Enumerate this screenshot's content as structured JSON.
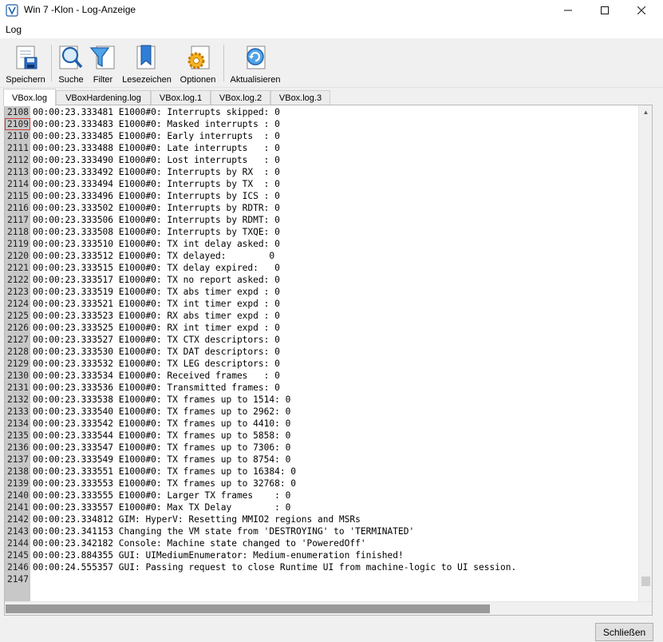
{
  "window": {
    "title": "Win 7 -Klon - Log-Anzeige"
  },
  "menu": {
    "items": [
      "Log"
    ]
  },
  "toolbar": {
    "buttons": [
      {
        "label": "Speichern",
        "icon": "save-icon"
      },
      {
        "label": "Suche",
        "icon": "search-icon"
      },
      {
        "label": "Filter",
        "icon": "filter-icon"
      },
      {
        "label": "Lesezeichen",
        "icon": "bookmark-icon"
      },
      {
        "label": "Optionen",
        "icon": "gear-icon"
      },
      {
        "label": "Aktualisieren",
        "icon": "refresh-icon"
      }
    ]
  },
  "tabs": [
    "VBox.log",
    "VBoxHardening.log",
    "VBox.log.1",
    "VBox.log.2",
    "VBox.log.3"
  ],
  "active_tab": 0,
  "log": {
    "selected_line": "2109",
    "lines": [
      {
        "n": "2108",
        "t": "00:00:23.333481 E1000#0: Interrupts skipped: 0"
      },
      {
        "n": "2109",
        "t": "00:00:23.333483 E1000#0: Masked interrupts : 0"
      },
      {
        "n": "2110",
        "t": "00:00:23.333485 E1000#0: Early interrupts  : 0"
      },
      {
        "n": "2111",
        "t": "00:00:23.333488 E1000#0: Late interrupts   : 0"
      },
      {
        "n": "2112",
        "t": "00:00:23.333490 E1000#0: Lost interrupts   : 0"
      },
      {
        "n": "2113",
        "t": "00:00:23.333492 E1000#0: Interrupts by RX  : 0"
      },
      {
        "n": "2114",
        "t": "00:00:23.333494 E1000#0: Interrupts by TX  : 0"
      },
      {
        "n": "2115",
        "t": "00:00:23.333496 E1000#0: Interrupts by ICS : 0"
      },
      {
        "n": "2116",
        "t": "00:00:23.333502 E1000#0: Interrupts by RDTR: 0"
      },
      {
        "n": "2117",
        "t": "00:00:23.333506 E1000#0: Interrupts by RDMT: 0"
      },
      {
        "n": "2118",
        "t": "00:00:23.333508 E1000#0: Interrupts by TXQE: 0"
      },
      {
        "n": "2119",
        "t": "00:00:23.333510 E1000#0: TX int delay asked: 0"
      },
      {
        "n": "2120",
        "t": "00:00:23.333512 E1000#0: TX delayed:        0"
      },
      {
        "n": "2121",
        "t": "00:00:23.333515 E1000#0: TX delay expired:   0"
      },
      {
        "n": "2122",
        "t": "00:00:23.333517 E1000#0: TX no report asked: 0"
      },
      {
        "n": "2123",
        "t": "00:00:23.333519 E1000#0: TX abs timer expd : 0"
      },
      {
        "n": "2124",
        "t": "00:00:23.333521 E1000#0: TX int timer expd : 0"
      },
      {
        "n": "2125",
        "t": "00:00:23.333523 E1000#0: RX abs timer expd : 0"
      },
      {
        "n": "2126",
        "t": "00:00:23.333525 E1000#0: RX int timer expd : 0"
      },
      {
        "n": "2127",
        "t": "00:00:23.333527 E1000#0: TX CTX descriptors: 0"
      },
      {
        "n": "2128",
        "t": "00:00:23.333530 E1000#0: TX DAT descriptors: 0"
      },
      {
        "n": "2129",
        "t": "00:00:23.333532 E1000#0: TX LEG descriptors: 0"
      },
      {
        "n": "2130",
        "t": "00:00:23.333534 E1000#0: Received frames   : 0"
      },
      {
        "n": "2131",
        "t": "00:00:23.333536 E1000#0: Transmitted frames: 0"
      },
      {
        "n": "2132",
        "t": "00:00:23.333538 E1000#0: TX frames up to 1514: 0"
      },
      {
        "n": "2133",
        "t": "00:00:23.333540 E1000#0: TX frames up to 2962: 0"
      },
      {
        "n": "2134",
        "t": "00:00:23.333542 E1000#0: TX frames up to 4410: 0"
      },
      {
        "n": "2135",
        "t": "00:00:23.333544 E1000#0: TX frames up to 5858: 0"
      },
      {
        "n": "2136",
        "t": "00:00:23.333547 E1000#0: TX frames up to 7306: 0"
      },
      {
        "n": "2137",
        "t": "00:00:23.333549 E1000#0: TX frames up to 8754: 0"
      },
      {
        "n": "2138",
        "t": "00:00:23.333551 E1000#0: TX frames up to 16384: 0"
      },
      {
        "n": "2139",
        "t": "00:00:23.333553 E1000#0: TX frames up to 32768: 0"
      },
      {
        "n": "2140",
        "t": "00:00:23.333555 E1000#0: Larger TX frames    : 0"
      },
      {
        "n": "2141",
        "t": "00:00:23.333557 E1000#0: Max TX Delay        : 0"
      },
      {
        "n": "2142",
        "t": "00:00:23.334812 GIM: HyperV: Resetting MMIO2 regions and MSRs"
      },
      {
        "n": "2143",
        "t": "00:00:23.341153 Changing the VM state from 'DESTROYING' to 'TERMINATED'"
      },
      {
        "n": "2144",
        "t": "00:00:23.342182 Console: Machine state changed to 'PoweredOff'"
      },
      {
        "n": "2145",
        "t": "00:00:23.884355 GUI: UIMediumEnumerator: Medium-enumeration finished!"
      },
      {
        "n": "2146",
        "t": "00:00:24.555357 GUI: Passing request to close Runtime UI from machine-logic to UI session."
      },
      {
        "n": "2147",
        "t": ""
      }
    ]
  },
  "scroll": {
    "horizontal_fraction": 0.75,
    "vertical_position": 1.0
  },
  "buttons": {
    "close_label": "Schließen"
  }
}
